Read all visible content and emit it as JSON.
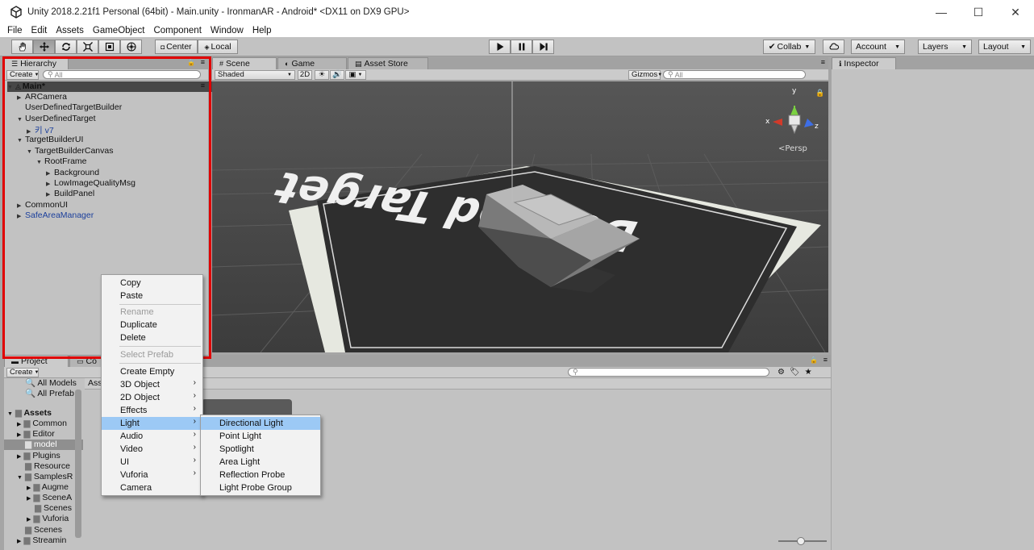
{
  "window": {
    "title": "Unity 2018.2.21f1 Personal (64bit) - Main.unity - IronmanAR - Android* <DX11 on DX9 GPU>",
    "minimize": "—",
    "maximize": "☐",
    "close": "✕"
  },
  "menu": [
    "File",
    "Edit",
    "Assets",
    "GameObject",
    "Component",
    "Window",
    "Help"
  ],
  "toolbar": {
    "pivot": "Center",
    "space": "Local",
    "collab": "Collab",
    "account": "Account",
    "layers": "Layers",
    "layout": "Layout"
  },
  "hierarchy": {
    "tab": "Hierarchy",
    "create": "Create",
    "search_placeholder": "All",
    "scene": "Main*",
    "items": [
      {
        "label": "ARCamera"
      },
      {
        "label": "UserDefinedTargetBuilder"
      },
      {
        "label": "UserDefinedTarget"
      },
      {
        "label": "키 v7"
      },
      {
        "label": "TargetBuilderUI"
      },
      {
        "label": "TargetBuilderCanvas"
      },
      {
        "label": "RootFrame"
      },
      {
        "label": "Background"
      },
      {
        "label": "LowImageQualityMsg"
      },
      {
        "label": "BuildPanel"
      },
      {
        "label": "CommonUI"
      },
      {
        "label": "SafeAreaManager"
      }
    ]
  },
  "scene_view": {
    "tabs": [
      "Scene",
      "Game",
      "Asset Store"
    ],
    "shading": "Shaded",
    "mode_2d": "2D",
    "gizmos": "Gizmos",
    "search_placeholder": "All",
    "persp": "Persp",
    "axis_x": "x",
    "axis_y": "y",
    "axis_z": "z",
    "target_text": "Defined Target"
  },
  "inspector": {
    "tab": "Inspector"
  },
  "project": {
    "tabs": [
      "Project",
      "Co"
    ],
    "create": "Create",
    "breadcrumb": "Ass",
    "favorites": [
      "All Models",
      "All Prefab"
    ],
    "assets_root": "Assets",
    "folders": [
      "Common",
      "Editor",
      "model",
      "Plugins",
      "Resource",
      "SamplesR",
      "Augme",
      "SceneA",
      "Scenes",
      "Vuforia",
      "Scenes",
      "Streamin"
    ]
  },
  "context_menu": {
    "items": [
      {
        "label": "Copy"
      },
      {
        "label": "Paste"
      },
      {
        "label": "Rename"
      },
      {
        "label": "Duplicate"
      },
      {
        "label": "Delete"
      },
      {
        "label": "Select Prefab"
      },
      {
        "label": "Create Empty"
      },
      {
        "label": "3D Object"
      },
      {
        "label": "2D Object"
      },
      {
        "label": "Effects"
      },
      {
        "label": "Light"
      },
      {
        "label": "Audio"
      },
      {
        "label": "Video"
      },
      {
        "label": "UI"
      },
      {
        "label": "Vuforia"
      },
      {
        "label": "Camera"
      }
    ],
    "submenu_arrow": "›"
  },
  "light_submenu": {
    "items": [
      {
        "label": "Directional Light"
      },
      {
        "label": "Point Light"
      },
      {
        "label": "Spotlight"
      },
      {
        "label": "Area Light"
      },
      {
        "label": "Reflection Probe"
      },
      {
        "label": "Light Probe Group"
      }
    ]
  },
  "colors": {
    "highlight": "#9cc9f5",
    "annotation_box": "#e00000",
    "prefab_blue": "#1b3f9c"
  }
}
